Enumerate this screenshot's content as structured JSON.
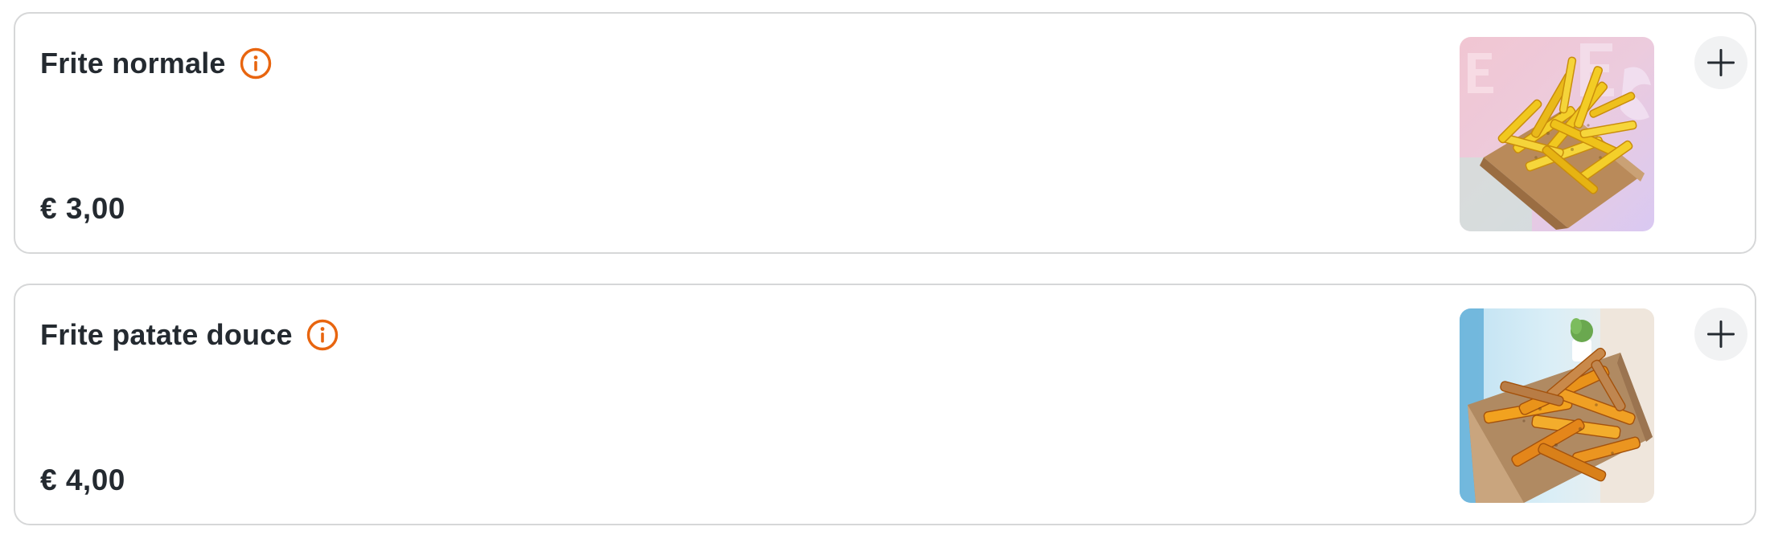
{
  "products": [
    {
      "name": "Frite normale",
      "price": "€ 3,00",
      "image_label": "fries-photo"
    },
    {
      "name": "Frite patate douce",
      "price": "€ 4,00",
      "image_label": "sweet-potato-fries-photo"
    }
  ],
  "icons": {
    "info": "info-circle-icon",
    "add": "plus-icon"
  },
  "colors": {
    "accent": "#e8650f",
    "text": "#242a30",
    "card_border": "#d6d7d8",
    "button_bg": "#f1f2f3"
  }
}
